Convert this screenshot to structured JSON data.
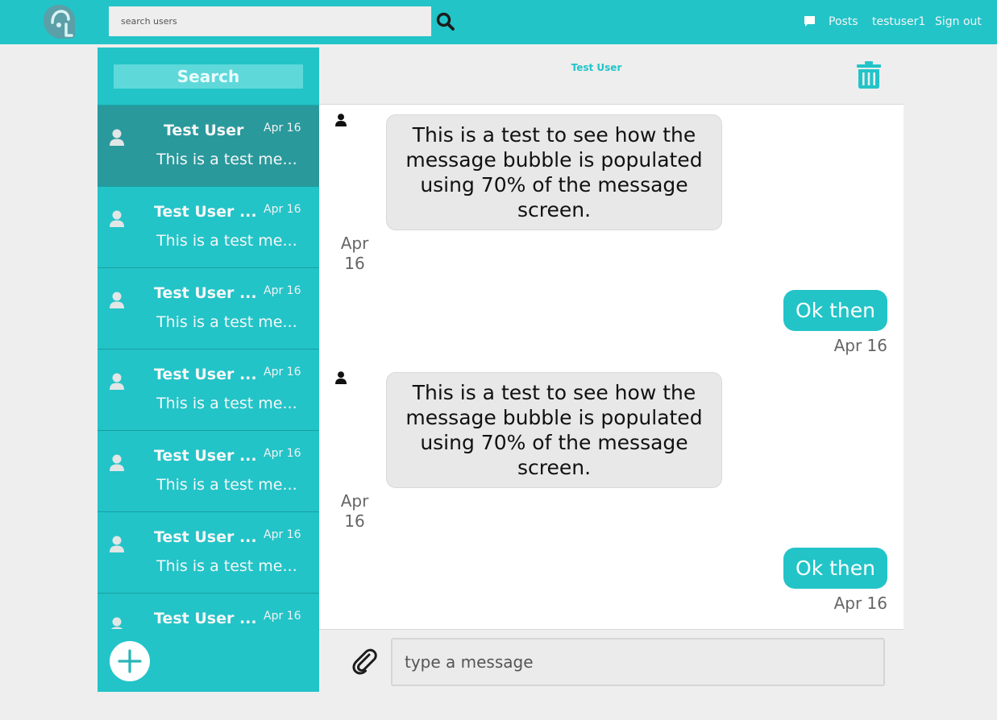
{
  "navbar": {
    "logo_icon": "ear-logo-icon",
    "search_placeholder": "search users",
    "search_icon": "search-icon",
    "chat_icon": "chat-bubble-icon",
    "posts_label": "Posts",
    "username": "testuser1",
    "signout_label": "Sign out"
  },
  "sidebar": {
    "search_placeholder": "Search",
    "conversations": [
      {
        "name": "Test User",
        "date": "Apr 16",
        "preview": "This is a test me..."
      },
      {
        "name": "Test User ...",
        "date": "Apr 16",
        "preview": "This is a test me..."
      },
      {
        "name": "Test User ...",
        "date": "Apr 16",
        "preview": "This is a test me..."
      },
      {
        "name": "Test User ...",
        "date": "Apr 16",
        "preview": "This is a test me..."
      },
      {
        "name": "Test User ...",
        "date": "Apr 16",
        "preview": "This is a test me..."
      },
      {
        "name": "Test User ...",
        "date": "Apr 16",
        "preview": "This is a test me..."
      },
      {
        "name": "Test User ...",
        "date": "Apr 16",
        "preview": ""
      }
    ],
    "add_icon": "plus-icon"
  },
  "chat": {
    "title": "Test User",
    "delete_icon": "trash-icon",
    "messages": [
      {
        "direction": "in",
        "text": "This is a test to see how the message bubble is populated using 70% of the message screen.",
        "date": "Apr 16"
      },
      {
        "direction": "out",
        "text": "Ok then",
        "date": "Apr 16"
      },
      {
        "direction": "in",
        "text": "This is a test to see how the message bubble is populated using 70% of the message screen.",
        "date": "Apr 16"
      },
      {
        "direction": "out",
        "text": "Ok then",
        "date": "Apr 16"
      }
    ]
  },
  "composer": {
    "attach_icon": "paperclip-icon",
    "placeholder": "type a message"
  },
  "colors": {
    "accent": "#22c4c8",
    "active_conversation": "#29999c",
    "incoming_bubble": "#e8e8e8",
    "background": "#eeeeee"
  }
}
